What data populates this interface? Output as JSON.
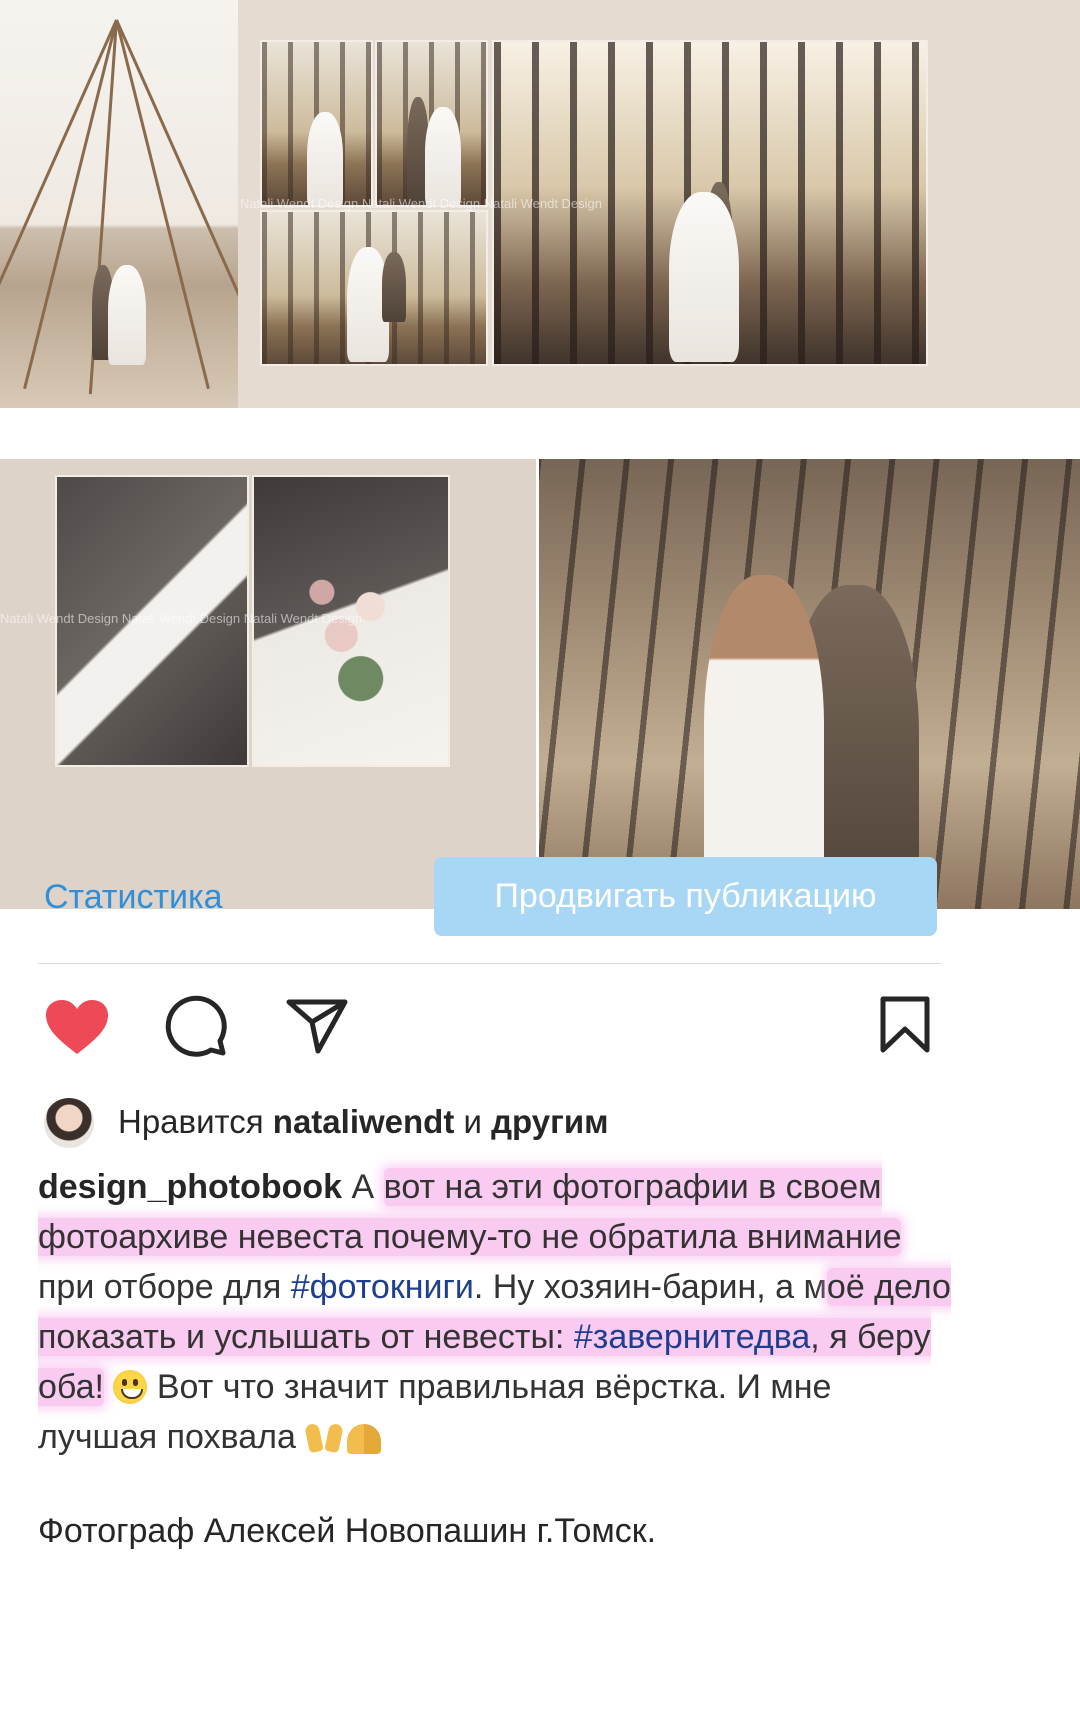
{
  "post": {
    "watermark": "Natali Wendt Design Natali Wendt Design Natali Wendt Design",
    "stats_label": "Статистика",
    "promote_label": "Продвигать публикацию"
  },
  "actions": {
    "like_icon": "heart-filled-icon",
    "comment_icon": "comment-icon",
    "share_icon": "paper-plane-icon",
    "save_icon": "bookmark-icon",
    "like_color": "#ed4956"
  },
  "likes": {
    "prefix": "Нравится",
    "user": "nataliwendt",
    "middle": "и",
    "others": "другим"
  },
  "caption": {
    "username": "design_photobook",
    "seg1": " А ",
    "hl1": "вот на эти фотографии в своем фотоархиве невеста почему-то не обратила внимание",
    "seg2": " при отборе для ",
    "tag1": "#фотокниги",
    "seg3": ". Ну хозяин-барин, а м",
    "hl2a": "оё дело показать и услышать от невесты: ",
    "tag2": "#завернитедва",
    "hl2b": ", я беру оба!",
    "seg4": " ",
    "seg5": " Вот что значит правильная вёрстка. И мне лучшая похвала ",
    "photographer": "Фотограф Алексей Новопашин г.Томск."
  }
}
